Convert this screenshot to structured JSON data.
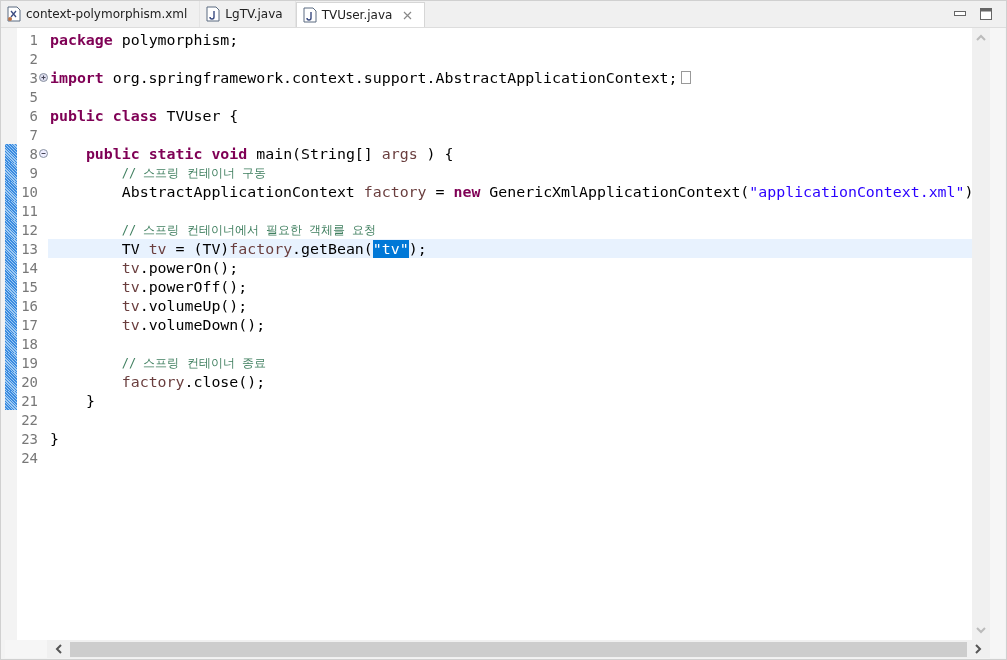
{
  "tabs": [
    {
      "label": "context-polymorphism.xml",
      "kind": "xml",
      "selected": false,
      "closable": false
    },
    {
      "label": "LgTV.java",
      "kind": "java",
      "selected": false,
      "closable": false
    },
    {
      "label": "TVUser.java",
      "kind": "java",
      "selected": true,
      "closable": true
    }
  ],
  "editor": {
    "lines": [
      {
        "number": "1",
        "current": false,
        "changed": false,
        "foldable": false,
        "tokens": [
          {
            "kind": "keyword",
            "text": "package"
          },
          {
            "kind": "plain",
            "text": " polymorphism;"
          }
        ]
      },
      {
        "number": "2",
        "current": false,
        "changed": false,
        "foldable": false
      },
      {
        "number": "3",
        "current": false,
        "changed": false,
        "foldable": true,
        "collapsed": true,
        "tokens": [
          {
            "kind": "keyword",
            "text": "import"
          },
          {
            "kind": "plain",
            "text": " org.springframework.context.support.AbstractApplicationContext;"
          }
        ]
      },
      {
        "number": "5",
        "current": false,
        "changed": false,
        "foldable": false
      },
      {
        "number": "6",
        "current": false,
        "changed": false,
        "foldable": false,
        "tokens": [
          {
            "kind": "keyword",
            "text": "public"
          },
          {
            "kind": "keyword",
            "text": " class"
          },
          {
            "kind": "plain",
            "text": " TVUser {"
          }
        ]
      },
      {
        "number": "7",
        "current": false,
        "changed": false,
        "foldable": false
      },
      {
        "number": "8",
        "current": false,
        "changed": true,
        "foldable": true,
        "collapsed": false,
        "tokens": [
          {
            "kind": "keyword",
            "text": "    public"
          },
          {
            "kind": "keyword",
            "text": " static"
          },
          {
            "kind": "keyword",
            "text": " void"
          },
          {
            "kind": "plain",
            "text": " main(String[] "
          },
          {
            "kind": "variable",
            "text": "args"
          },
          {
            "kind": "plain",
            "text": " ) {"
          }
        ]
      },
      {
        "number": "9",
        "current": false,
        "changed": true,
        "foldable": false,
        "tokens": [
          {
            "kind": "comment",
            "text": "        // 스프링 컨테이너 구동"
          }
        ]
      },
      {
        "number": "10",
        "current": false,
        "changed": true,
        "foldable": false,
        "tokens": [
          {
            "kind": "plain",
            "text": "        AbstractApplicationContext "
          },
          {
            "kind": "variable",
            "text": "factory"
          },
          {
            "kind": "plain",
            "text": " = "
          },
          {
            "kind": "keyword",
            "text": "new"
          },
          {
            "kind": "plain",
            "text": " GenericXmlApplicationContext("
          },
          {
            "kind": "string",
            "text": "\"applicationContext.xml\""
          },
          {
            "kind": "plain",
            "text": ")"
          }
        ]
      },
      {
        "number": "11",
        "current": false,
        "changed": true,
        "foldable": false
      },
      {
        "number": "12",
        "current": false,
        "changed": true,
        "foldable": false,
        "tokens": [
          {
            "kind": "comment",
            "text": "        // 스프링 컨테이너에서 필요한 객체를 요청"
          }
        ]
      },
      {
        "number": "13",
        "current": true,
        "changed": true,
        "foldable": false,
        "tokens": [
          {
            "kind": "plain",
            "text": "        TV "
          },
          {
            "kind": "variable",
            "text": "tv"
          },
          {
            "kind": "plain",
            "text": " = (TV)"
          },
          {
            "kind": "variable",
            "text": "factory"
          },
          {
            "kind": "plain",
            "text": ".getBean("
          },
          {
            "kind": "selected",
            "text": "\"tv\""
          },
          {
            "kind": "plain",
            "text": ");"
          }
        ]
      },
      {
        "number": "14",
        "current": false,
        "changed": true,
        "foldable": false,
        "tokens": [
          {
            "kind": "variable",
            "text": "        tv"
          },
          {
            "kind": "plain",
            "text": ".powerOn();"
          }
        ]
      },
      {
        "number": "15",
        "current": false,
        "changed": true,
        "foldable": false,
        "tokens": [
          {
            "kind": "variable",
            "text": "        tv"
          },
          {
            "kind": "plain",
            "text": ".powerOff();"
          }
        ]
      },
      {
        "number": "16",
        "current": false,
        "changed": true,
        "foldable": false,
        "tokens": [
          {
            "kind": "variable",
            "text": "        tv"
          },
          {
            "kind": "plain",
            "text": ".volumeUp();"
          }
        ]
      },
      {
        "number": "17",
        "current": false,
        "changed": true,
        "foldable": false,
        "tokens": [
          {
            "kind": "variable",
            "text": "        tv"
          },
          {
            "kind": "plain",
            "text": ".volumeDown();"
          }
        ]
      },
      {
        "number": "18",
        "current": false,
        "changed": true,
        "foldable": false
      },
      {
        "number": "19",
        "current": false,
        "changed": true,
        "foldable": false,
        "tokens": [
          {
            "kind": "comment",
            "text": "        // 스프링 컨테이너 종료"
          }
        ]
      },
      {
        "number": "20",
        "current": false,
        "changed": true,
        "foldable": false,
        "tokens": [
          {
            "kind": "variable",
            "text": "        factory"
          },
          {
            "kind": "plain",
            "text": ".close();"
          }
        ]
      },
      {
        "number": "21",
        "current": false,
        "changed": true,
        "foldable": false,
        "tokens": [
          {
            "kind": "plain",
            "text": "    }"
          }
        ]
      },
      {
        "number": "22",
        "current": false,
        "changed": false,
        "foldable": false
      },
      {
        "number": "23",
        "current": false,
        "changed": false,
        "foldable": false,
        "tokens": [
          {
            "kind": "plain",
            "text": "}"
          }
        ]
      },
      {
        "number": "24",
        "current": false,
        "changed": false,
        "foldable": false
      }
    ]
  }
}
